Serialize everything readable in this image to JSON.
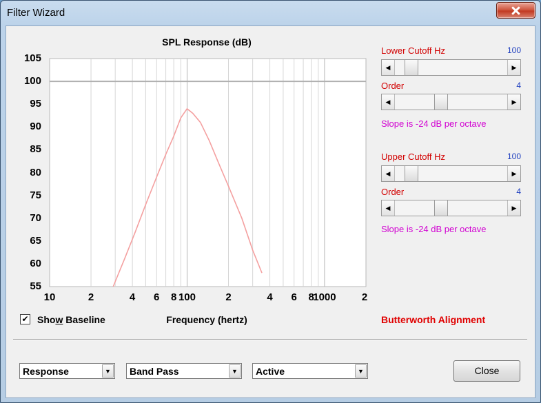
{
  "window": {
    "title": "Filter Wizard"
  },
  "chart": {
    "title": "SPL Response (dB)",
    "y_ticks": [
      "105",
      "100",
      "95",
      "90",
      "85",
      "80",
      "75",
      "70",
      "65",
      "60",
      "55"
    ],
    "x_ticks": [
      "10",
      "2",
      "4",
      "6",
      "8",
      "100",
      "2",
      "4",
      "6",
      "8",
      "1000",
      "2"
    ],
    "x_axis_title": "Frequency (hertz)"
  },
  "chart_data": {
    "type": "line",
    "title": "SPL Response (dB)",
    "xlabel": "Frequency (hertz)",
    "ylabel": "",
    "x_scale": "log",
    "xlim": [
      10,
      2000
    ],
    "ylim": [
      55,
      105
    ],
    "grid": true,
    "baseline": 100,
    "series": [
      {
        "x": [
          29,
          35,
          42,
          50,
          60,
          70,
          80,
          90,
          100,
          110,
          125,
          145,
          170,
          200,
          250,
          300,
          350
        ],
        "y": [
          55,
          61,
          67,
          73,
          79,
          84,
          88,
          92,
          94,
          93,
          91,
          87,
          82,
          77,
          70,
          63,
          58
        ],
        "color": "#f4a0a0"
      }
    ]
  },
  "show_baseline": {
    "label_before": "Sho",
    "label_underline": "w",
    "label_after": " Baseline",
    "checked": true
  },
  "alignment_label": "Butterworth Alignment",
  "lower": {
    "cutoff_label": "Lower Cutoff  Hz",
    "cutoff_value": "100",
    "cutoff_slider": 0.1,
    "order_label": "Order",
    "order_value": "4",
    "order_slider": 0.4,
    "slope_text": "Slope is -24 dB per octave"
  },
  "upper": {
    "cutoff_label": "Upper Cutoff  Hz",
    "cutoff_value": "100",
    "cutoff_slider": 0.1,
    "order_label": "Order",
    "order_value": "4",
    "order_slider": 0.4,
    "slope_text": "Slope is -24 dB per octave"
  },
  "combos": {
    "mode": "Response",
    "filter_type": "Band Pass",
    "circuit": "Active"
  },
  "close_button": "Close",
  "icons": {
    "left_arrow": "◀",
    "right_arrow": "▶",
    "dropdown": "▼",
    "check": "✔"
  },
  "colors": {
    "curve": "#f4a0a0",
    "label_red": "#d20000",
    "value_blue": "#1f3fbf",
    "slope_magenta": "#d100d1",
    "alignment_red": "#e00000"
  }
}
